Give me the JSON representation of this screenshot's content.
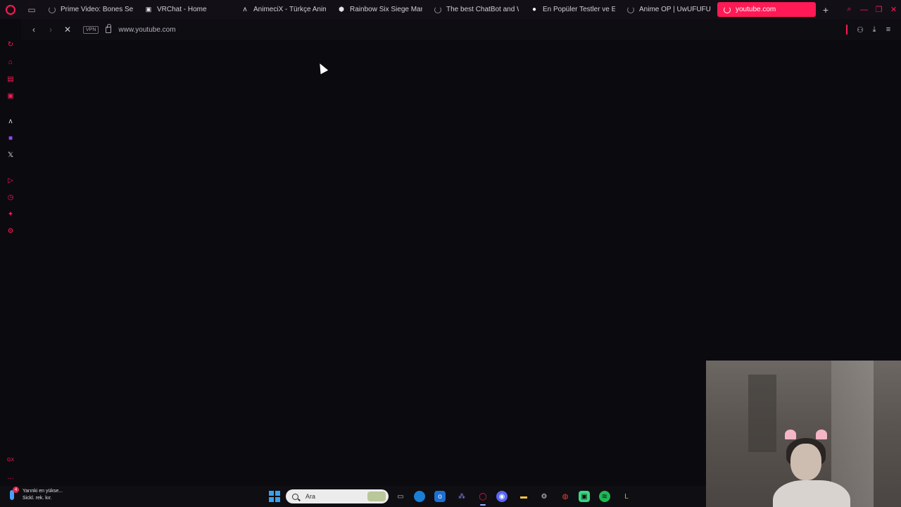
{
  "tabs": [
    {
      "title": "Prime Video: Bones Sea",
      "icon": "loading-spinner-icon",
      "active": false
    },
    {
      "title": "VRChat - Home",
      "icon": "vrchat-icon",
      "active": false
    },
    {
      "title": "AnimeciX - Türkçe Anim",
      "icon": "animecix-icon",
      "active": false
    },
    {
      "title": "Rainbow Six Siege Mark",
      "icon": "r6-icon",
      "active": false
    },
    {
      "title": "The best ChatBot and W",
      "icon": "loading-spinner-icon",
      "active": false
    },
    {
      "title": "En Popüler Testler ve Eğ",
      "icon": "chat-bubble-icon",
      "active": false
    },
    {
      "title": "Anime OP | UwUFUFU",
      "icon": "loading-spinner-icon",
      "active": false
    },
    {
      "title": "youtube.com",
      "icon": "loading-spinner-icon",
      "active": true
    }
  ],
  "addressbar": {
    "vpn_label": "VPN",
    "url": "www.youtube.com"
  },
  "taskbar": {
    "notification_line1": "Yarınki en yükse...",
    "notification_line2": "Sickl. rek. kır.",
    "notification_badge": "4",
    "search_placeholder": "Ara"
  },
  "colors": {
    "accent": "#ff1a55",
    "background": "#0b0a0f",
    "tab_strip": "#121016"
  }
}
